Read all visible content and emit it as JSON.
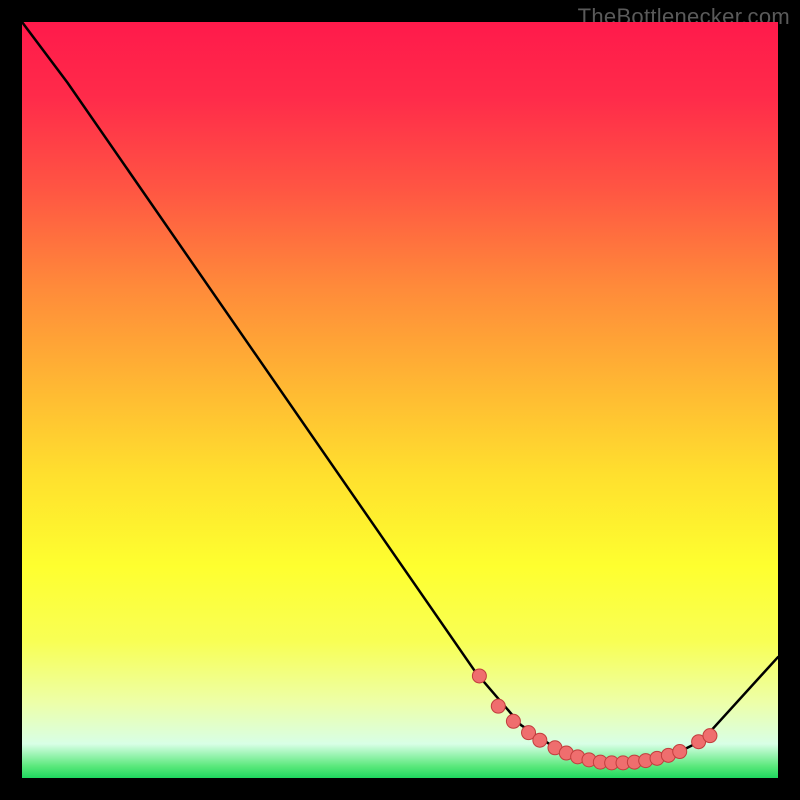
{
  "watermark": "TheBottlenecker.com",
  "chart_data": {
    "type": "line",
    "title": "",
    "xlabel": "",
    "ylabel": "",
    "xlim": [
      0,
      100
    ],
    "ylim": [
      0,
      100
    ],
    "grid": false,
    "legend": false,
    "series": [
      {
        "name": "curve",
        "x": [
          0,
          6,
          60,
          66,
          72,
          78,
          82,
          86,
          90,
          100
        ],
        "y": [
          100,
          92,
          14,
          7,
          3,
          2,
          2,
          3,
          5,
          16
        ]
      }
    ],
    "markers": {
      "name": "dots",
      "x": [
        60.5,
        63,
        65,
        67,
        68.5,
        70.5,
        72,
        73.5,
        75,
        76.5,
        78,
        79.5,
        81,
        82.5,
        84,
        85.5,
        87,
        89.5,
        91
      ],
      "y": [
        13.5,
        9.5,
        7.5,
        6,
        5,
        4,
        3.3,
        2.8,
        2.4,
        2.1,
        2,
        2,
        2.1,
        2.3,
        2.6,
        3,
        3.5,
        4.8,
        5.6
      ]
    },
    "background_gradient": {
      "stops": [
        {
          "offset": 0.0,
          "color": "#ff1a4b"
        },
        {
          "offset": 0.1,
          "color": "#ff2b4a"
        },
        {
          "offset": 0.22,
          "color": "#ff5543"
        },
        {
          "offset": 0.35,
          "color": "#ff8a3a"
        },
        {
          "offset": 0.48,
          "color": "#ffb733"
        },
        {
          "offset": 0.6,
          "color": "#ffe02e"
        },
        {
          "offset": 0.72,
          "color": "#feff2f"
        },
        {
          "offset": 0.82,
          "color": "#f8ff55"
        },
        {
          "offset": 0.9,
          "color": "#edffa8"
        },
        {
          "offset": 0.955,
          "color": "#d8ffe6"
        },
        {
          "offset": 0.985,
          "color": "#58e87a"
        },
        {
          "offset": 1.0,
          "color": "#1fd65e"
        }
      ]
    },
    "style": {
      "marker_fill": "#ef6e6e",
      "marker_stroke": "#c23d3d",
      "marker_radius": 7,
      "line_color": "#000000",
      "line_width": 2.5
    }
  }
}
